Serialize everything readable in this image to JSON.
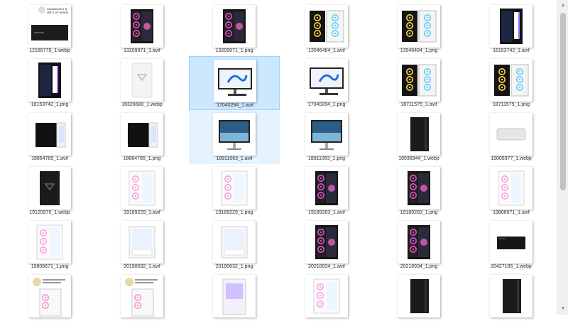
{
  "files": [
    {
      "name": "12165779_1.webp",
      "type": "minipc-badge"
    },
    {
      "name": "13209971_1.avif",
      "type": "pc-black-rgb"
    },
    {
      "name": "13209971_1.png",
      "type": "pc-black-rgb"
    },
    {
      "name": "13546484_1.avif",
      "type": "pc-black-dual"
    },
    {
      "name": "13546484_1.png",
      "type": "pc-black-dual"
    },
    {
      "name": "16153742_1.avif",
      "type": "pc-black-tall"
    },
    {
      "name": "16153742_1.png",
      "type": "pc-black-tall"
    },
    {
      "name": "16326680_1.webp",
      "type": "pc-white-tower"
    },
    {
      "name": "17040284_1.avif",
      "type": "aio"
    },
    {
      "name": "17040284_1.png",
      "type": "aio"
    },
    {
      "name": "18711575_1.avif",
      "type": "pc-black-dual"
    },
    {
      "name": "18711575_1.png",
      "type": "pc-black-dual"
    },
    {
      "name": "18864785_1.avif",
      "type": "pc-cube"
    },
    {
      "name": "18864785_1.png",
      "type": "pc-cube"
    },
    {
      "name": "18911063_1.avif",
      "type": "aio-landscape"
    },
    {
      "name": "18911063_1.png",
      "type": "aio-landscape"
    },
    {
      "name": "18936944_1.webp",
      "type": "pc-black-plain"
    },
    {
      "name": "19005977_1.webp",
      "type": "macmini"
    },
    {
      "name": "19120970_1.webp",
      "type": "pc-black-v"
    },
    {
      "name": "19189229_1.avif",
      "type": "pc-white-rgb"
    },
    {
      "name": "19189229_1.png",
      "type": "pc-white-rgb"
    },
    {
      "name": "19189283_1.avif",
      "type": "pc-black-rgb"
    },
    {
      "name": "19189283_1.png",
      "type": "pc-black-rgb"
    },
    {
      "name": "19806671_1.avif",
      "type": "pc-white-rgb"
    },
    {
      "name": "19806671_1.png",
      "type": "pc-white-rgb"
    },
    {
      "name": "20190632_1.avif",
      "type": "pc-white-open"
    },
    {
      "name": "20190632_1.png",
      "type": "pc-white-open"
    },
    {
      "name": "20218934_1.avif",
      "type": "pc-black-rgb"
    },
    {
      "name": "20218934_1.png",
      "type": "pc-black-rgb"
    },
    {
      "name": "20427185_1.webp",
      "type": "minipc"
    },
    {
      "name": "",
      "type": "pc-badge-white"
    },
    {
      "name": "",
      "type": "pc-badge-white"
    },
    {
      "name": "",
      "type": "pc-white-purple"
    },
    {
      "name": "",
      "type": "pc-white-rgb"
    },
    {
      "name": "",
      "type": "pc-black-plain"
    },
    {
      "name": "",
      "type": "pc-black-plain"
    }
  ],
  "selected_index": 8,
  "hover_index": 14,
  "colors": {
    "selected_bg": "#cce8ff",
    "selected_border": "#99d1ff",
    "hover_bg": "#e5f3ff"
  },
  "badges": {
    "danawa_line1": "DANAWA 2021 상",
    "danawa_line2": "상반기 HIT BRAND"
  },
  "scrollbar": {
    "up_icon": "chevron-up-icon",
    "down_icon": "chevron-down-icon"
  }
}
